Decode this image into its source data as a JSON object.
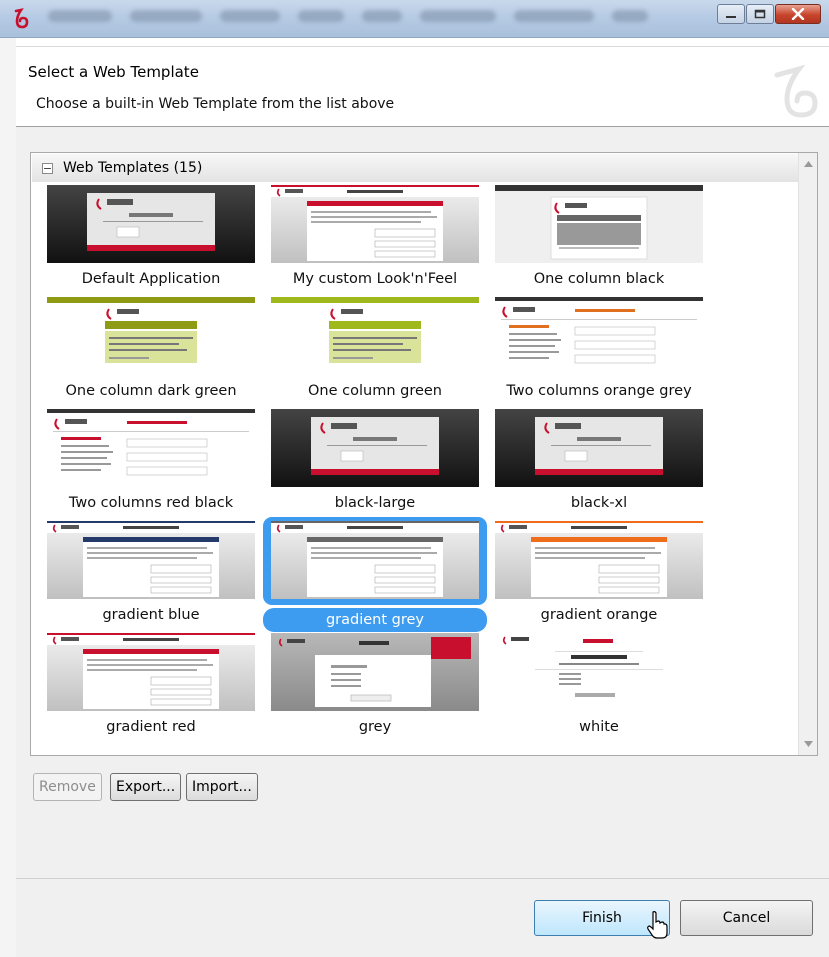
{
  "window": {
    "controls": [
      "minimize-icon",
      "maximize-icon",
      "close-icon"
    ]
  },
  "header": {
    "title": "Select a Web Template",
    "description": "Choose a built-in Web Template from the list above"
  },
  "gallery": {
    "group_label": "Web Templates (15)",
    "templates": [
      {
        "label": "Default Application",
        "style": "dark"
      },
      {
        "label": "My custom Look'n'Feel",
        "style": "red"
      },
      {
        "label": "One column black",
        "style": "black"
      },
      {
        "label": "One column dark green",
        "style": "darkgreen"
      },
      {
        "label": "One column green",
        "style": "green"
      },
      {
        "label": "Two columns orange grey",
        "style": "twocol-orange"
      },
      {
        "label": "Two columns red black",
        "style": "twocol-red"
      },
      {
        "label": "black-large",
        "style": "dark"
      },
      {
        "label": "black-xl",
        "style": "dark"
      },
      {
        "label": "gradient blue",
        "style": "blue"
      },
      {
        "label": "gradient grey",
        "style": "grey"
      },
      {
        "label": "gradient orange",
        "style": "orange"
      },
      {
        "label": "gradient red",
        "style": "red"
      },
      {
        "label": "grey",
        "style": "plaingrey"
      },
      {
        "label": "white",
        "style": "white"
      }
    ],
    "selected": "gradient grey"
  },
  "actions": {
    "remove": "Remove",
    "export": "Export...",
    "import": "Import..."
  },
  "footer": {
    "finish": "Finish",
    "cancel": "Cancel"
  },
  "colors": {
    "selection": "#3d9cf0",
    "brand_red": "#c8102e"
  }
}
